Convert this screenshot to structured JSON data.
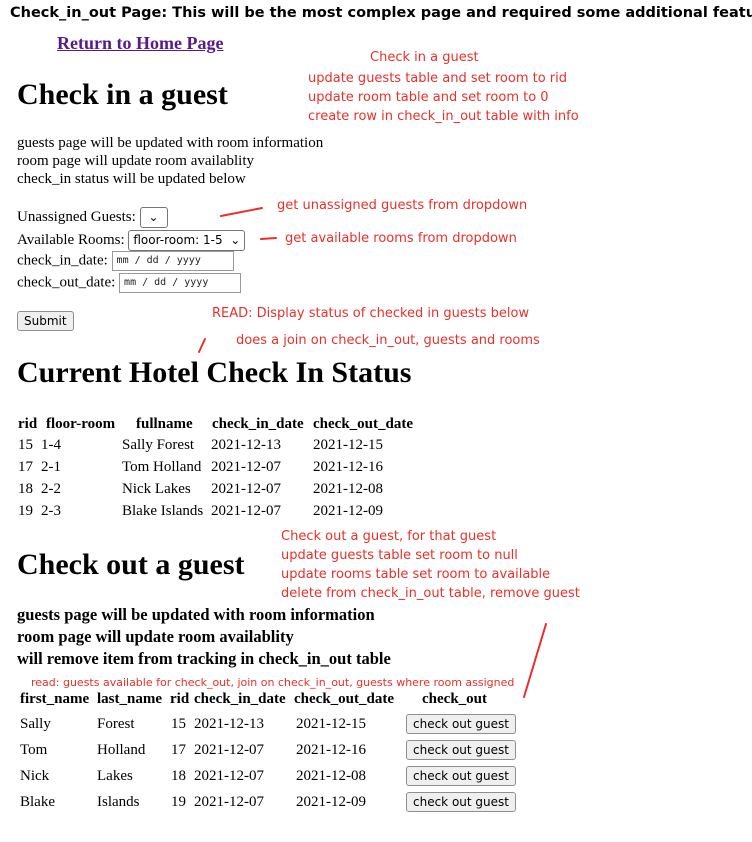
{
  "header": {
    "title": "Check_in_out Page: This will be the most complex page and required some additional features"
  },
  "nav": {
    "return_link": "Return to Home Page"
  },
  "checkin": {
    "title": "Check in a guest",
    "lines": [
      "guests page will be updated with room information",
      "room page will update room availablity",
      "check_in status will be updated below"
    ],
    "unassigned_label": "Unassigned Guests:",
    "rooms_label": "Available Rooms:",
    "rooms_selected": "floor-room: 1-5",
    "check_in_label": "check_in_date:",
    "check_out_label": "check_out_date:",
    "date_placeholder": "mm / dd / yyyy",
    "submit_label": "Submit"
  },
  "status": {
    "title": "Current Hotel Check In Status",
    "headers": [
      "rid",
      "floor-room",
      "fullname",
      "check_in_date",
      "check_out_date"
    ],
    "rows": [
      [
        "15",
        "1-4",
        "Sally Forest",
        "2021-12-13",
        "2021-12-15"
      ],
      [
        "17",
        "2-1",
        "Tom Holland",
        "2021-12-07",
        "2021-12-16"
      ],
      [
        "18",
        "2-2",
        "Nick Lakes",
        "2021-12-07",
        "2021-12-08"
      ],
      [
        "19",
        "2-3",
        "Blake Islands",
        "2021-12-07",
        "2021-12-09"
      ]
    ]
  },
  "checkout": {
    "title": "Check out a guest",
    "lines": [
      "guests page will be updated with room information",
      "room page will update room availablity",
      "will remove item from tracking in check_in_out table"
    ],
    "headers": [
      "first_name",
      "last_name",
      "rid",
      "check_in_date",
      "check_out_date",
      "check_out"
    ],
    "rows": [
      [
        "Sally",
        "Forest",
        "15",
        "2021-12-13",
        "2021-12-15"
      ],
      [
        "Tom",
        "Holland",
        "17",
        "2021-12-07",
        "2021-12-16"
      ],
      [
        "Nick",
        "Lakes",
        "18",
        "2021-12-07",
        "2021-12-08"
      ],
      [
        "Blake",
        "Islands",
        "19",
        "2021-12-07",
        "2021-12-09"
      ]
    ],
    "button_label": "check out guest"
  },
  "notes": {
    "checkin": [
      "Check in a guest",
      "update guests table and set room to rid",
      "update room table and set room to 0",
      "create row in check_in_out table with info"
    ],
    "unassigned": "get unassigned guests from dropdown",
    "rooms": "get available rooms from dropdown",
    "read_status": "READ: Display status of checked in guests below",
    "join": "does a join on check_in_out, guests and rooms",
    "checkout": [
      "Check out a guest, for that guest",
      "update guests table set room to null",
      "update rooms table set room to available",
      "delete from check_in_out table, remove guest"
    ],
    "read_checkout": "read: guests available for check_out, join on check_in_out, guests where room assigned"
  },
  "colors": {
    "annotation": "#e8302a",
    "link": "#551a8b"
  }
}
